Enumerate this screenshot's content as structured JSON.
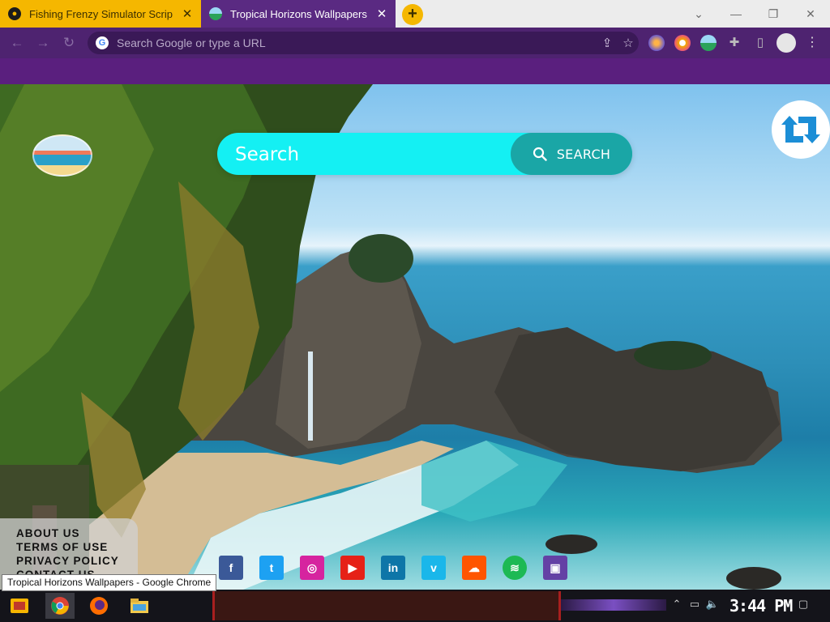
{
  "tabs": [
    {
      "title": "Fishing Frenzy Simulator Scrip",
      "active": false,
      "close_glyph": "✕",
      "icon": "gamepad-icon"
    },
    {
      "title": "Tropical Horizons Wallpapers",
      "active": true,
      "close_glyph": "✕",
      "icon": "tropical-favicon-icon"
    }
  ],
  "new_tab_glyph": "+",
  "omnibox": {
    "placeholder": "Search Google or type a URL"
  },
  "page": {
    "search": {
      "placeholder": "Search",
      "button_label": "SEARCH"
    },
    "footer_links": [
      "ABOUT US",
      "TERMS OF USE",
      "PRIVACY POLICY",
      "CONTACT US"
    ],
    "social": [
      {
        "name": "facebook",
        "glyph": "f",
        "color": "#3b5998"
      },
      {
        "name": "twitter",
        "glyph": "t",
        "color": "#1da1f2"
      },
      {
        "name": "instagram",
        "glyph": "◎",
        "color": "#d6249f"
      },
      {
        "name": "youtube",
        "glyph": "▶",
        "color": "#e62117"
      },
      {
        "name": "linkedin",
        "glyph": "in",
        "color": "#0e76a8"
      },
      {
        "name": "vimeo",
        "glyph": "v",
        "color": "#1ab7ea"
      },
      {
        "name": "soundcloud",
        "glyph": "☁",
        "color": "#ff5500"
      },
      {
        "name": "spotify",
        "glyph": "≋",
        "color": "#1db954"
      },
      {
        "name": "twitch",
        "glyph": "▣",
        "color": "#6441a5"
      }
    ]
  },
  "tooltip": "Tropical Horizons Wallpapers - Google Chrome",
  "taskbar": {
    "clock": "3:44 PM"
  }
}
